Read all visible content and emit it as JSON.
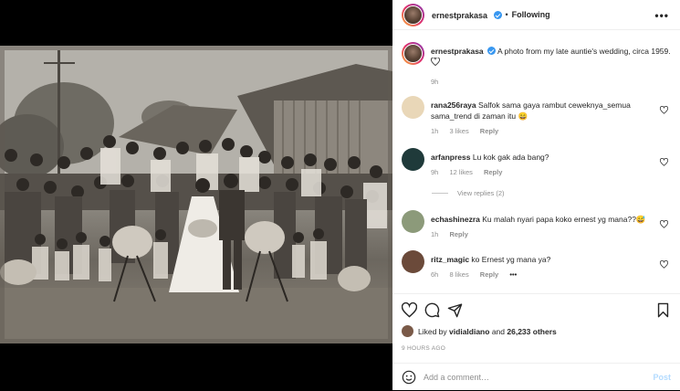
{
  "post": {
    "author": "ernestprakasa",
    "follow_label": "Following",
    "separator": "•",
    "more_label": "•••",
    "caption": "A photo from my late auntie's wedding, circa 1959.",
    "caption_time": "9h",
    "image": "old black-and-white wedding group photo"
  },
  "comments": [
    {
      "user": "rana256raya",
      "text": "Salfok sama gaya rambut ceweknya_semua sama_trend di zaman itu 😄",
      "time": "1h",
      "likes": "3 likes",
      "reply": "Reply",
      "avatar_color": "#e9d7b8"
    },
    {
      "user": "arfanpress",
      "text": "Lu kok gak ada bang?",
      "time": "9h",
      "likes": "12 likes",
      "reply": "Reply",
      "avatar_color": "#1f3a3a",
      "view_replies": "View replies (2)"
    },
    {
      "user": "echashinezra",
      "text": "Ku malah nyari papa koko ernest yg mana??😅",
      "time": "1h",
      "reply": "Reply",
      "avatar_color": "#8c9a7a"
    },
    {
      "user": "ritz_magic",
      "text": "ko Ernest yg mana ya?",
      "time": "6h",
      "likes": "8 likes",
      "reply": "Reply",
      "more": "•••",
      "avatar_color": "#6b4a3a"
    }
  ],
  "actions": {
    "icons": [
      "heart-icon",
      "comment-icon",
      "share-icon",
      "bookmark-icon"
    ],
    "liked_by_prefix": "Liked by",
    "liked_by_user": "vidialdiano",
    "liked_by_and": "and",
    "others": "26,233 others",
    "timestamp": "9 HOURS AGO"
  },
  "add_comment": {
    "placeholder": "Add a comment…",
    "post_label": "Post",
    "emoji_icon": "smiley-icon"
  }
}
